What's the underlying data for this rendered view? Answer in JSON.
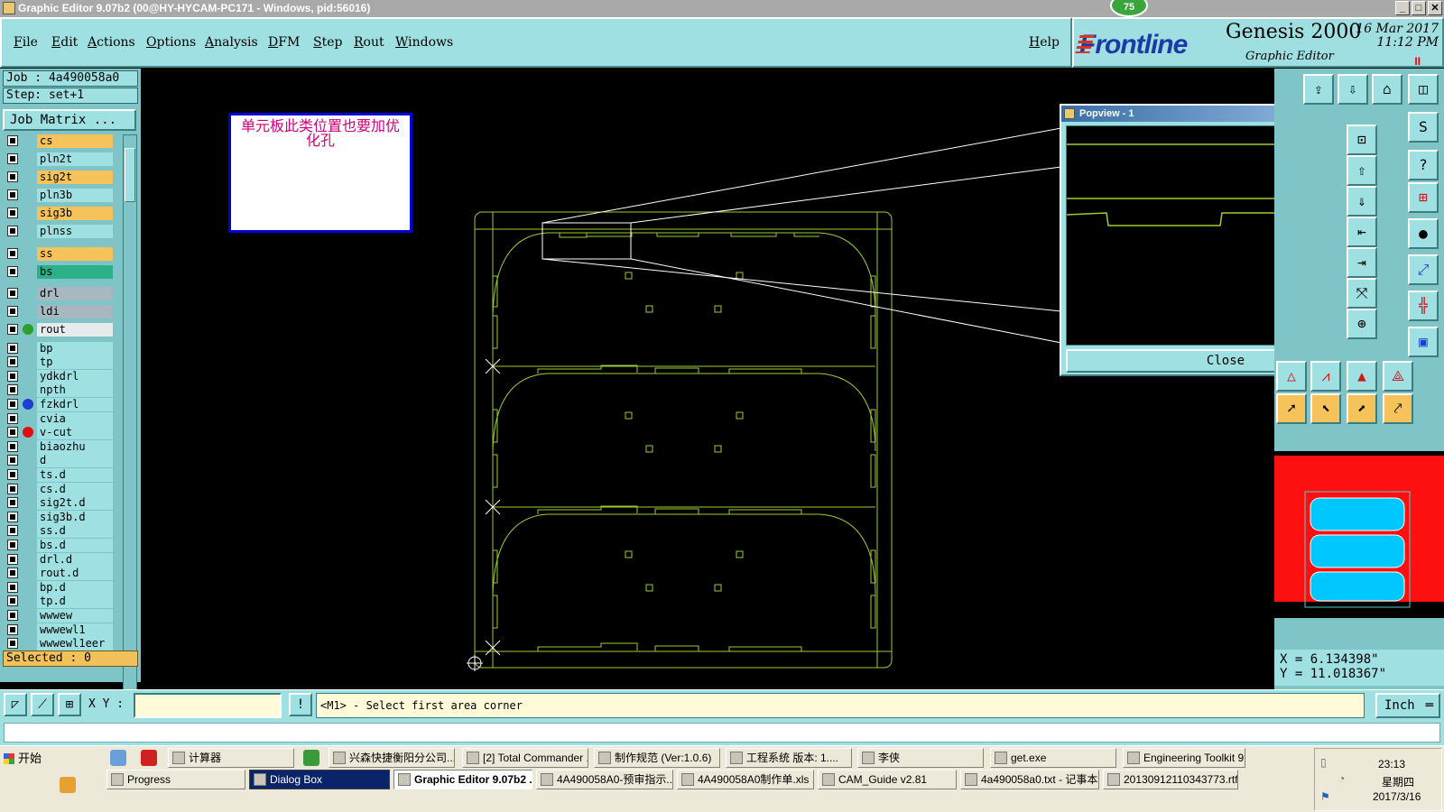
{
  "window": {
    "title": "Graphic Editor 9.07b2 (00@HY-HYCAM-PC171 - Windows, pid:56016)",
    "badge": "75",
    "controls": [
      "_",
      "□",
      "✕"
    ]
  },
  "menu": {
    "items": [
      "File",
      "Edit",
      "Actions",
      "Options",
      "Analysis",
      "DFM",
      "Step",
      "Rout",
      "Windows"
    ],
    "help": "Help"
  },
  "brand": {
    "logo": "Frontline",
    "product": "Genesis 2000",
    "subtitle": "Graphic Editor",
    "date": "16 Mar 2017",
    "time": "11:12 PM",
    "pause_glyph": "II"
  },
  "left_panel": {
    "job": "Job : 4a490058a0",
    "step": "Step: set+1",
    "job_matrix": "Job Matrix ...",
    "selected": "Selected : 0",
    "layers": [
      {
        "name": "cs",
        "color": "#f6c35a",
        "dot": ""
      },
      {
        "name": "pln2t",
        "color": "#9fe0e2",
        "dot": ""
      },
      {
        "name": "sig2t",
        "color": "#f6c35a",
        "dot": ""
      },
      {
        "name": "pln3b",
        "color": "#9fe0e2",
        "dot": ""
      },
      {
        "name": "sig3b",
        "color": "#f6c35a",
        "dot": ""
      },
      {
        "name": "plnss",
        "color": "#9fe0e2",
        "dot": ""
      },
      {
        "name": "ss",
        "color": "#f6c35a",
        "dot": ""
      },
      {
        "name": "bs",
        "color": "#2bb08a",
        "dot": ""
      },
      {
        "name": "drl",
        "color": "#a7b8c0",
        "dot": ""
      },
      {
        "name": "ldi",
        "color": "#a7b8c0",
        "dot": ""
      },
      {
        "name": "rout",
        "color": "#e6ebec",
        "dot": "#2d9e2d"
      },
      {
        "name": "bp",
        "color": "#9fe0e2",
        "dot": ""
      },
      {
        "name": "tp",
        "color": "#9fe0e2",
        "dot": ""
      },
      {
        "name": "ydkdrl",
        "color": "#9fe0e2",
        "dot": ""
      },
      {
        "name": "npth",
        "color": "#9fe0e2",
        "dot": ""
      },
      {
        "name": "fzkdrl",
        "color": "#9fe0e2",
        "dot": "#1b3fd0"
      },
      {
        "name": "cvia",
        "color": "#9fe0e2",
        "dot": ""
      },
      {
        "name": "v-cut",
        "color": "#9fe0e2",
        "dot": "#e01010"
      },
      {
        "name": "biaozhu",
        "color": "#9fe0e2",
        "dot": ""
      },
      {
        "name": "d",
        "color": "#9fe0e2",
        "dot": ""
      },
      {
        "name": "ts.d",
        "color": "#9fe0e2",
        "dot": ""
      },
      {
        "name": "cs.d",
        "color": "#9fe0e2",
        "dot": ""
      },
      {
        "name": "sig2t.d",
        "color": "#9fe0e2",
        "dot": ""
      },
      {
        "name": "sig3b.d",
        "color": "#9fe0e2",
        "dot": ""
      },
      {
        "name": "ss.d",
        "color": "#9fe0e2",
        "dot": ""
      },
      {
        "name": "bs.d",
        "color": "#9fe0e2",
        "dot": ""
      },
      {
        "name": "drl.d",
        "color": "#9fe0e2",
        "dot": ""
      },
      {
        "name": "rout.d",
        "color": "#9fe0e2",
        "dot": ""
      },
      {
        "name": "bp.d",
        "color": "#9fe0e2",
        "dot": ""
      },
      {
        "name": "tp.d",
        "color": "#9fe0e2",
        "dot": ""
      },
      {
        "name": "wwwew",
        "color": "#9fe0e2",
        "dot": ""
      },
      {
        "name": "wwwewl1",
        "color": "#9fe0e2",
        "dot": ""
      },
      {
        "name": "wwwewl1eer",
        "color": "#9fe0e2",
        "dot": ""
      }
    ]
  },
  "note": {
    "text": "单元板此类位置也要加优化孔"
  },
  "popview": {
    "title": "Popview - 1",
    "close_label": "Close"
  },
  "coords": {
    "x": "X = 6.134398\"",
    "y": "Y = 11.018367\""
  },
  "command_bar": {
    "xy_label": "X Y :",
    "xy_value": "",
    "info_glyph": "!",
    "prompt": "<M1> - Select first area corner",
    "unit": "Inch"
  },
  "taskbar": {
    "start": "开始",
    "row1": [
      {
        "label": "计算器"
      },
      {
        "label": "兴森快捷衡阳分公司..."
      },
      {
        "label": "[2] Total Commander ..."
      },
      {
        "label": "制作规范 (Ver:1.0.6)"
      },
      {
        "label": "工程系统  版本: 1...."
      },
      {
        "label": "李侠"
      },
      {
        "label": "get.exe"
      },
      {
        "label": "Engineering Toolkit 9...."
      }
    ],
    "row2": [
      {
        "label": "Progress"
      },
      {
        "label": "Dialog Box"
      },
      {
        "label": "Graphic Editor 9.07b2 ..."
      },
      {
        "label": "4A490058A0-预审指示...."
      },
      {
        "label": "4A490058A0制作单.xls ..."
      },
      {
        "label": "CAM_Guide v2.81"
      },
      {
        "label": "4a490058a0.txt - 记事本"
      },
      {
        "label": "20130912110343773.rtf..."
      }
    ],
    "clock": {
      "time": "23:13",
      "day": "星期四",
      "date": "2017/3/16"
    }
  },
  "colors": {
    "panel": "#9fe0e2",
    "outline": "#9acd32",
    "highlight_layer": "#f6c35a"
  }
}
